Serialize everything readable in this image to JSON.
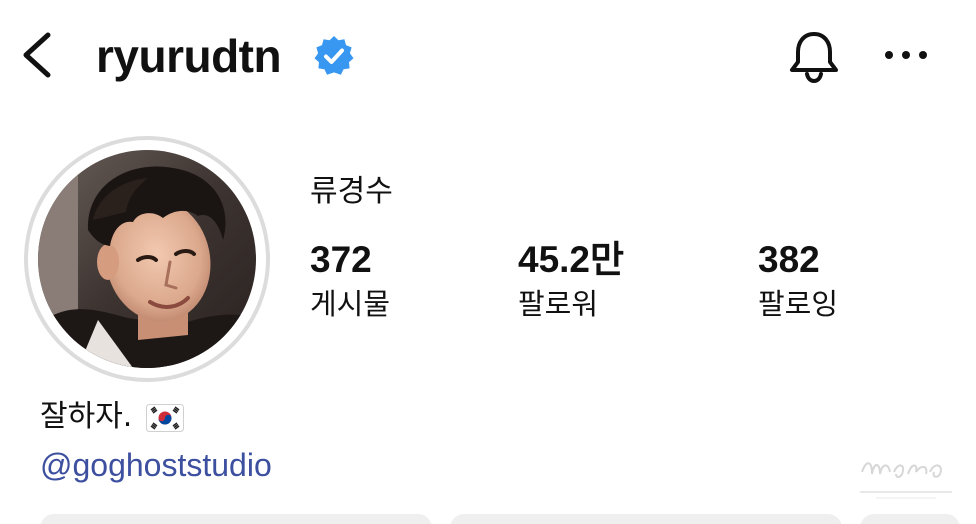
{
  "header": {
    "username": "ryurudtn",
    "verified": true,
    "back_icon": "chevron-left-icon",
    "bell_icon": "bell-icon",
    "more_icon": "more-horizontal-icon"
  },
  "profile": {
    "display_name": "류경수",
    "stats": [
      {
        "value": "372",
        "label": "게시물"
      },
      {
        "value": "45.2만",
        "label": "팔로워"
      },
      {
        "value": "382",
        "label": "팔로잉"
      }
    ],
    "bio": "잘하자.",
    "bio_emoji": "south-korea-flag",
    "link": "@goghoststudio"
  },
  "colors": {
    "verified_blue": "#3897f0",
    "link_blue": "#3d4f9f",
    "button_gray": "#efefef",
    "avatar_ring": "#dcdcdc"
  }
}
